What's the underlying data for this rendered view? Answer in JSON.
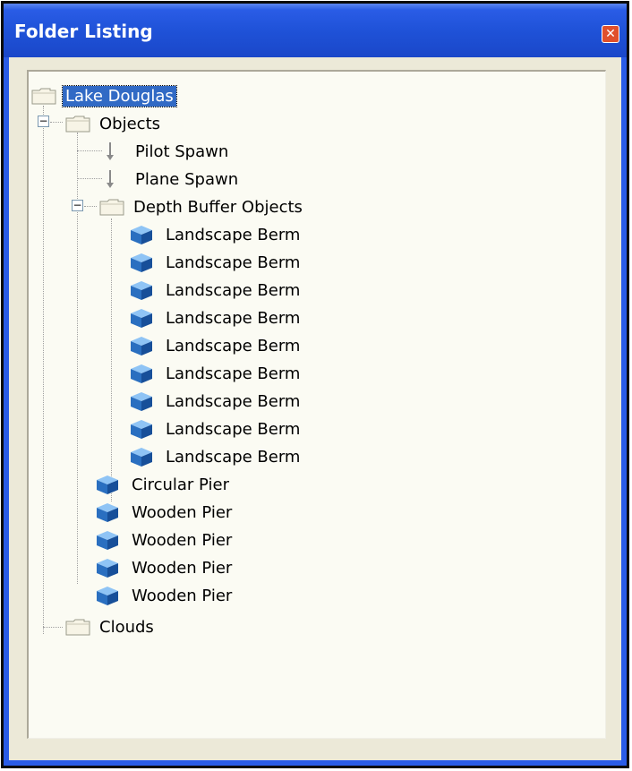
{
  "window": {
    "title": "Folder Listing",
    "close_label": "✕"
  },
  "tree": {
    "root": {
      "label": "Lake Douglas",
      "selected": true
    },
    "objects": {
      "label": "Objects",
      "expanded": true,
      "children": {
        "pilot_spawn": "Pilot Spawn",
        "plane_spawn": "Plane Spawn",
        "depth_buffer": {
          "label": "Depth Buffer Objects",
          "expanded": true,
          "items": [
            "Landscape Berm",
            "Landscape Berm",
            "Landscape Berm",
            "Landscape Berm",
            "Landscape Berm",
            "Landscape Berm",
            "Landscape Berm",
            "Landscape Berm",
            "Landscape Berm"
          ]
        },
        "piers": [
          "Circular Pier",
          "Wooden Pier",
          "Wooden Pier",
          "Wooden Pier",
          "Wooden Pier"
        ]
      }
    },
    "clouds": {
      "label": "Clouds"
    },
    "expander_symbol": "−"
  },
  "colors": {
    "titlebar": "#2a5ce6",
    "selection": "#316ac5",
    "close_button": "#e0502b",
    "tree_background": "#fbfbf3"
  }
}
